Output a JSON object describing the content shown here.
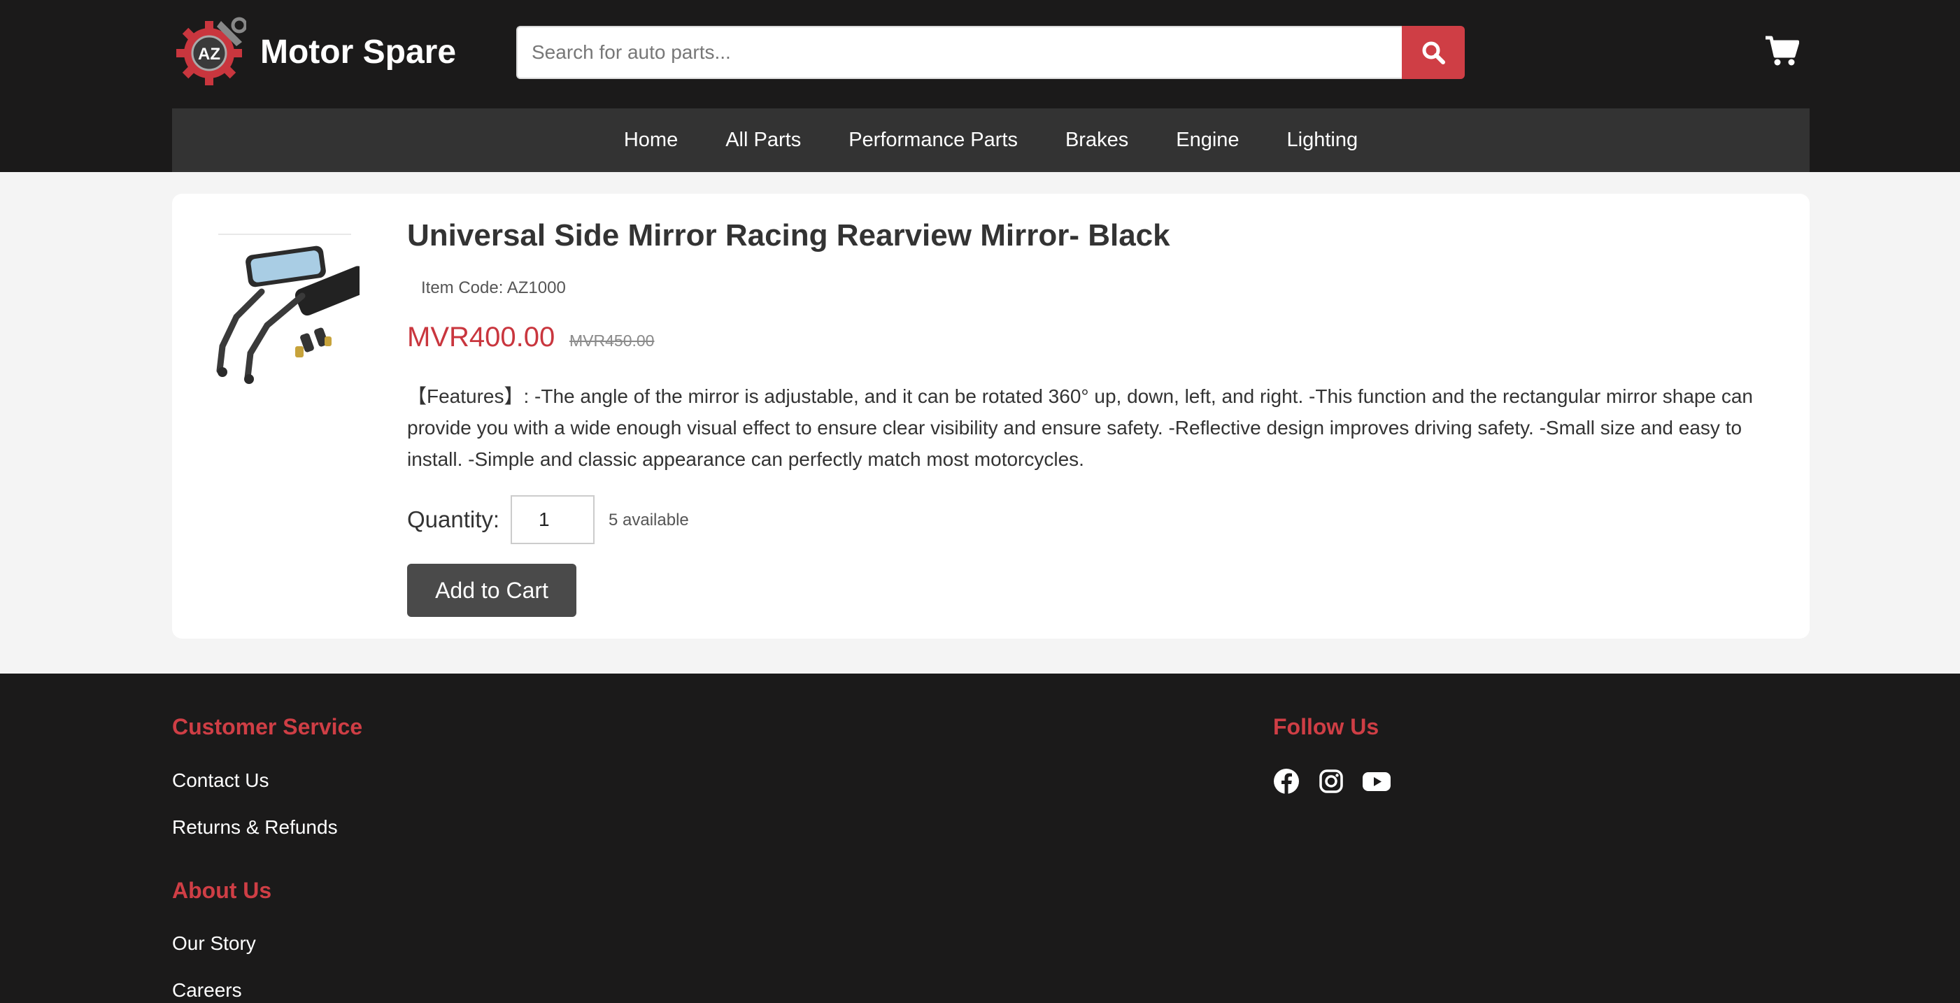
{
  "brand": {
    "name": "Motor Spare",
    "logo_letters": "AZ"
  },
  "search": {
    "placeholder": "Search for auto parts..."
  },
  "nav": {
    "items": [
      "Home",
      "All Parts",
      "Performance Parts",
      "Brakes",
      "Engine",
      "Lighting"
    ]
  },
  "product": {
    "title": "Universal Side Mirror Racing Rearview Mirror- Black",
    "item_code": "Item Code: AZ1000",
    "price": "MVR400.00",
    "old_price": "MVR450.00",
    "description": "【Features】: -The angle of the mirror is adjustable, and it can be rotated 360° up, down, left, and right. -This function and the rectangular mirror shape can provide you with a wide enough visual effect to ensure clear visibility and ensure safety. -Reflective design improves driving safety. -Small size and easy to install. -Simple and classic appearance can perfectly match most motorcycles.",
    "quantity_label": "Quantity:",
    "quantity_value": "1",
    "availability": "5 available",
    "add_to_cart_label": "Add to Cart"
  },
  "footer": {
    "customer_service": {
      "heading": "Customer Service",
      "links": [
        "Contact Us",
        "Returns & Refunds"
      ]
    },
    "about": {
      "heading": "About Us",
      "links": [
        "Our Story",
        "Careers"
      ]
    },
    "follow": {
      "heading": "Follow Us",
      "icons": [
        "facebook-icon",
        "instagram-icon",
        "youtube-icon"
      ]
    }
  },
  "colors": {
    "accent": "#cf3e45",
    "header_bg": "#1b1a1a",
    "nav_bg": "#333333",
    "button_dark": "#4a4a4a"
  }
}
